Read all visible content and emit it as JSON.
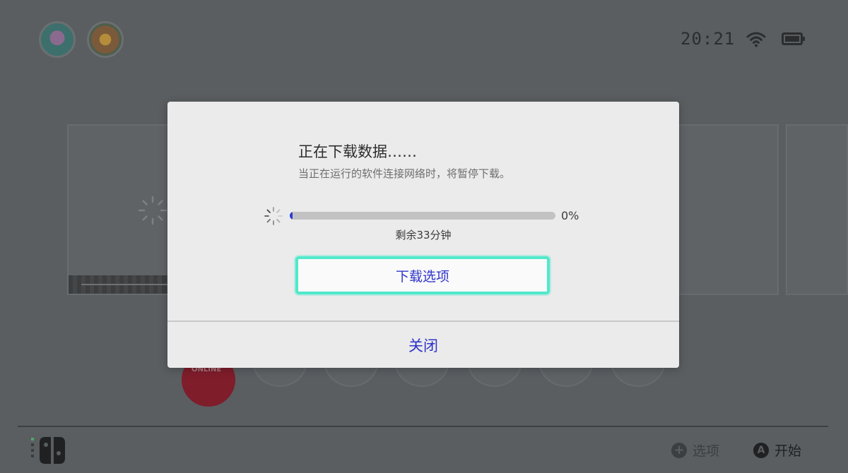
{
  "status_bar": {
    "time": "20:21",
    "wifi_icon": "wifi-icon",
    "battery_icon": "battery-icon"
  },
  "users": [
    {
      "icon": "user-avatar-icon"
    },
    {
      "icon": "user-avatar-icon"
    }
  ],
  "background": {
    "online_label": "ONLINE"
  },
  "dialog": {
    "title": "正在下载数据……",
    "subtitle": "当正在运行的软件连接网络时，将暂停下载。",
    "progress": 0,
    "progress_label": "0%",
    "remaining": "剩余33分钟",
    "options_button": "下载选项",
    "close_button": "关闭"
  },
  "footer": {
    "options_icon": "plus-button-icon",
    "options_label": "选项",
    "start_button": "A",
    "start_label": "开始"
  },
  "colors": {
    "accent": "#52e8cb",
    "link": "#2f34c9",
    "progress": "#2b3cd6"
  }
}
